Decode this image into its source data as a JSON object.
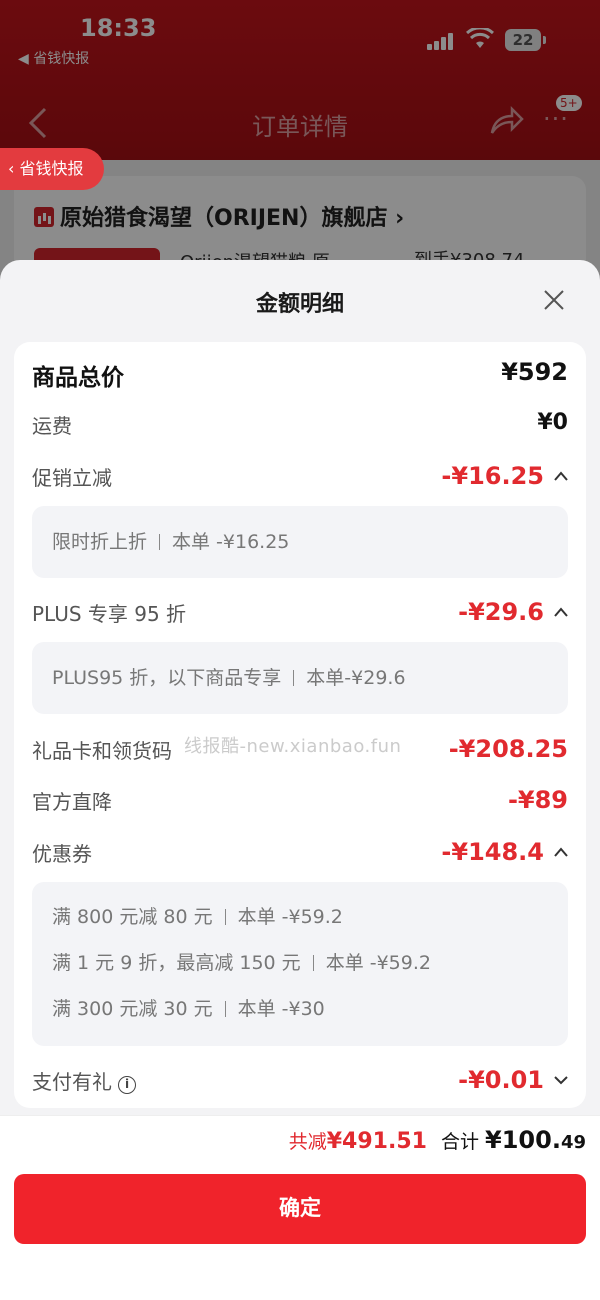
{
  "status": {
    "time": "18:33",
    "back_app": "◀ 省钱快报",
    "battery": "22"
  },
  "nav": {
    "title": "订单详情",
    "badge": "5+",
    "more": "···"
  },
  "savings_tab": "省钱快报",
  "shop": {
    "name": "原始猎食渴望（ORIJEN）旗舰店",
    "chevron": "›",
    "product_name": "Orijen渴望猫粮 原",
    "product_price": "到手¥308.74"
  },
  "sheet": {
    "title": "金额明细",
    "total": {
      "label": "商品总价",
      "value": "¥592"
    },
    "shipping": {
      "label": "运费",
      "value": "¥0"
    },
    "promo": {
      "label": "促销立减",
      "value": "-¥16.25",
      "details": [
        {
          "name": "限时折上折",
          "amount": "本单 -¥16.25"
        }
      ]
    },
    "plus": {
      "label": "PLUS 专享 95 折",
      "value": "-¥29.6",
      "details": [
        {
          "name": "PLUS95 折，以下商品专享",
          "amount": "本单-¥29.6"
        }
      ]
    },
    "giftcard": {
      "label": "礼品卡和领货码",
      "value": "-¥208.25"
    },
    "official": {
      "label": "官方直降",
      "value": "-¥89"
    },
    "coupon": {
      "label": "优惠券",
      "value": "-¥148.4",
      "details": [
        {
          "name": "满 800 元减 80 元",
          "amount": "本单 -¥59.2"
        },
        {
          "name": "满 1 元 9 折，最高减 150 元",
          "amount": "本单 -¥59.2"
        },
        {
          "name": "满 300 元减 30 元",
          "amount": "本单 -¥30"
        }
      ]
    },
    "paygift": {
      "label": "支付有礼",
      "value": "-¥0.01"
    },
    "watermark": "线报酷-new.xianbao.fun"
  },
  "footer": {
    "saved_label": "共减",
    "saved_value": "¥491.51",
    "total_label": "合计",
    "total_main": "¥100.",
    "total_cents": "49",
    "confirm": "确定"
  },
  "colors": {
    "accent": "#e12a2f",
    "button": "#f0232b",
    "header": "#c4151c"
  }
}
